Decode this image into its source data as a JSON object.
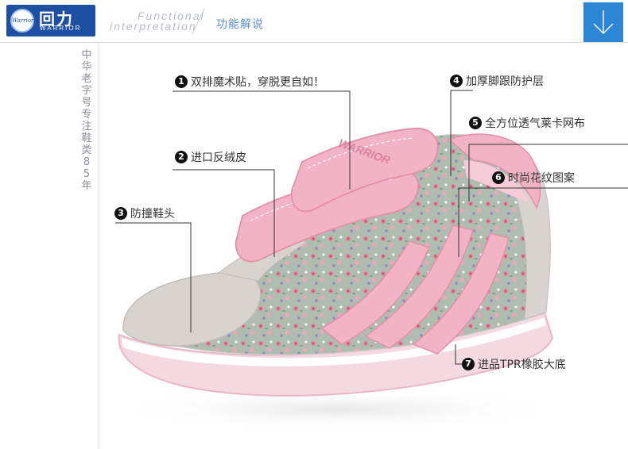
{
  "brand": {
    "name_cn": "回力",
    "name_en": "WARRIOR",
    "seal_text": "Warrior"
  },
  "section": {
    "title_en_line1": "Functional",
    "title_en_line2": "interpretation",
    "title_cn": "功能解说"
  },
  "rail": {
    "text": "中华老字号专注鞋类85年"
  },
  "callouts": [
    {
      "num": "1",
      "label": "双排魔术贴，穿脱更自如！"
    },
    {
      "num": "2",
      "label": "进口反绒皮"
    },
    {
      "num": "3",
      "label": "防撞鞋头"
    },
    {
      "num": "4",
      "label": "加厚脚跟防护层"
    },
    {
      "num": "5",
      "label": "全方位透气莱卡网布"
    },
    {
      "num": "6",
      "label": "时尚花纹图案"
    },
    {
      "num": "7",
      "label": "进品TPR橡胶大底"
    }
  ],
  "shoe": {
    "tongue_label": "WARRIOR",
    "colors": {
      "pink": "#f2b3c4",
      "pink_dark": "#e990a8",
      "suede": "#d9d3d0",
      "floral_bg": "#aebdb0",
      "sole": "#f5d9e1"
    }
  },
  "icons": {
    "down_arrow": "chevron-down-icon"
  }
}
